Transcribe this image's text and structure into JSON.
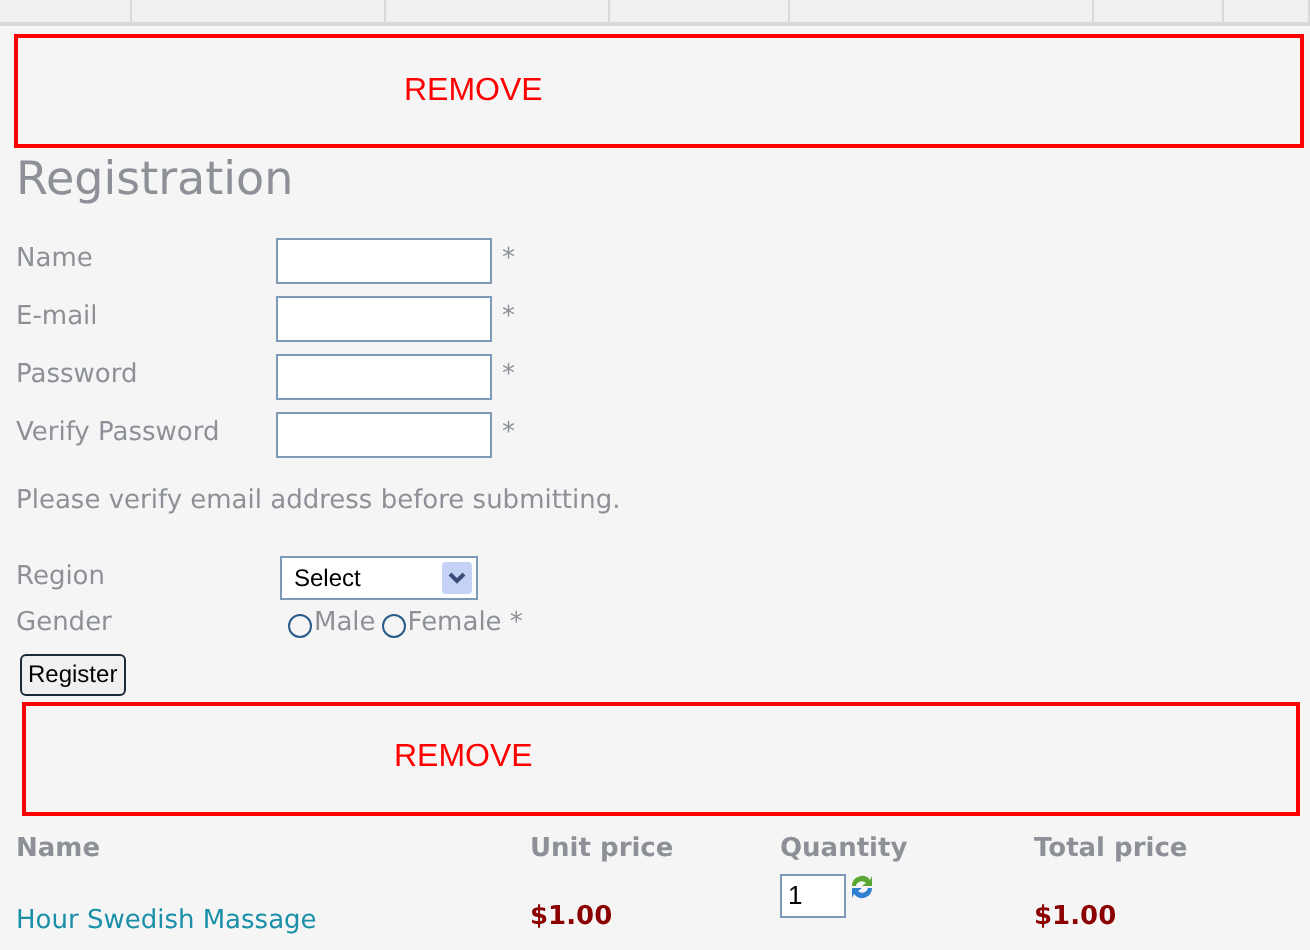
{
  "notices": [
    "REMOVE",
    "REMOVE"
  ],
  "heading": "Registration",
  "fields": [
    {
      "label": "Name",
      "required": "*"
    },
    {
      "label": "E-mail",
      "required": "*"
    },
    {
      "label": "Password",
      "required": "*"
    },
    {
      "label": "Verify Password",
      "required": "*"
    }
  ],
  "note": "Please verify email address before submitting.",
  "region": {
    "label": "Region",
    "value": "Select"
  },
  "gender": {
    "label": "Gender",
    "options": [
      {
        "label": "Male",
        "selected": false
      },
      {
        "label": "Female",
        "selected": false
      }
    ],
    "required": "*"
  },
  "register_button": "Register",
  "cart": {
    "columns": [
      "Name",
      "Unit price",
      "Quantity",
      "Total price"
    ],
    "rows": [
      {
        "name": "Hour Swedish Massage",
        "unit_price": "$1.00",
        "quantity": "1",
        "total_price": "$1.00"
      }
    ]
  }
}
